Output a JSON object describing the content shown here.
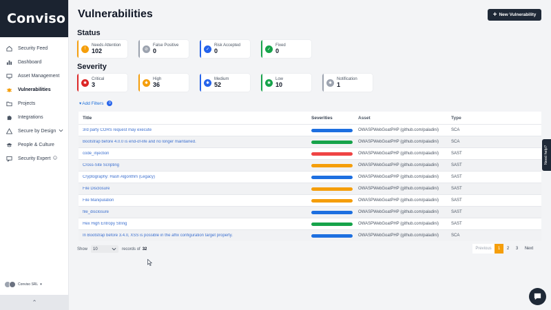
{
  "brand": {
    "logo": "Conviso"
  },
  "sidebar": {
    "items": [
      {
        "label": "Security Feed",
        "icon": "home-icon"
      },
      {
        "label": "Dashboard",
        "icon": "bar-chart-icon"
      },
      {
        "label": "Asset Management",
        "icon": "monitor-icon"
      },
      {
        "label": "Vulnerabilities",
        "icon": "bug-icon",
        "active": true
      },
      {
        "label": "Projects",
        "icon": "folder-icon"
      },
      {
        "label": "Integrations",
        "icon": "puzzle-icon"
      },
      {
        "label": "Secure by Design",
        "icon": "warning-icon"
      },
      {
        "label": "People & Culture",
        "icon": "graduation-cap-icon"
      },
      {
        "label": "Security Expert",
        "icon": "chat-icon"
      }
    ],
    "org_name": "Conviso SRL",
    "collapse_glyph": "⌃"
  },
  "page": {
    "title": "Vulnerabilities",
    "new_button": "New Vulnerability",
    "new_button_plus": "+"
  },
  "status": {
    "title": "Status",
    "cards": [
      {
        "label": "Needs Attention",
        "value": "102",
        "color": "#f59e0b",
        "icon": "warning-icon"
      },
      {
        "label": "False Positive",
        "value": "0",
        "color": "#9ca3af",
        "icon": "no-icon"
      },
      {
        "label": "Risk Accepted",
        "value": "0",
        "color": "#2563eb",
        "icon": "shield-icon"
      },
      {
        "label": "Fixed",
        "value": "0",
        "color": "#16a34a",
        "icon": "check-icon"
      }
    ]
  },
  "severity": {
    "title": "Severity",
    "cards": [
      {
        "label": "Critical",
        "value": "3",
        "color": "#dc2626"
      },
      {
        "label": "High",
        "value": "36",
        "color": "#f59e0b"
      },
      {
        "label": "Medium",
        "value": "52",
        "color": "#2563eb"
      },
      {
        "label": "Low",
        "value": "10",
        "color": "#16a34a"
      },
      {
        "label": "Notification",
        "value": "1",
        "color": "#9ca3af"
      }
    ]
  },
  "filters": {
    "label": "Add Filters",
    "count": "0"
  },
  "table": {
    "headers": {
      "title": "Title",
      "severities": "Severities",
      "asset": "Asset",
      "type": "Type"
    },
    "rows": [
      {
        "title": "3rd party CORS request may execute",
        "severity_color": "#1d6fe0",
        "asset": "OWASPWebGoatPHP (github.com/paladini)",
        "type": "SCA"
      },
      {
        "title": "Bootstrap before 4.0.0 is end-of-life and no longer maintained.",
        "severity_color": "#16a34a",
        "asset": "OWASPWebGoatPHP (github.com/paladini)",
        "type": "SCA"
      },
      {
        "title": "code_injection",
        "severity_color": "#ef4444",
        "asset": "OWASPWebGoatPHP (github.com/paladini)",
        "type": "SAST"
      },
      {
        "title": "Cross-Site Scripting",
        "severity_color": "#f59e0b",
        "asset": "OWASPWebGoatPHP (github.com/paladini)",
        "type": "SAST"
      },
      {
        "title": "Cryptography: Hash Algorithm (Legacy)",
        "severity_color": "#1d6fe0",
        "asset": "OWASPWebGoatPHP (github.com/paladini)",
        "type": "SAST"
      },
      {
        "title": "File Disclosure",
        "severity_color": "#f59e0b",
        "asset": "OWASPWebGoatPHP (github.com/paladini)",
        "type": "SAST"
      },
      {
        "title": "File Manipulation",
        "severity_color": "#f59e0b",
        "asset": "OWASPWebGoatPHP (github.com/paladini)",
        "type": "SAST"
      },
      {
        "title": "file_disclosure",
        "severity_color": "#1d6fe0",
        "asset": "OWASPWebGoatPHP (github.com/paladini)",
        "type": "SAST"
      },
      {
        "title": "Hex High Entropy String",
        "severity_color": "#16a34a",
        "asset": "OWASPWebGoatPHP (github.com/paladini)",
        "type": "SAST"
      },
      {
        "title": "In Bootstrap before 3.4.0, XSS is possible in the affix configuration target property.",
        "severity_color": "#1d6fe0",
        "asset": "OWASPWebGoatPHP (github.com/paladini)",
        "type": "SCA"
      }
    ]
  },
  "pagination": {
    "show_label": "Show",
    "page_size": "10",
    "records_label": "records of",
    "records_total": "32",
    "previous": "Previous",
    "pages": [
      "1",
      "2",
      "3"
    ],
    "current": "1",
    "next": "Next"
  },
  "help_tab": "Need help?"
}
